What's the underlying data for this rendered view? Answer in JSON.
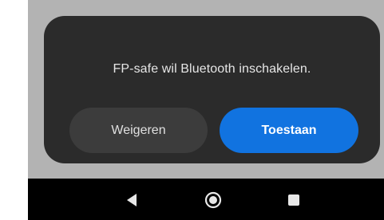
{
  "dialog": {
    "message": "FP-safe wil Bluetooth inschakelen.",
    "deny_label": "Weigeren",
    "allow_label": "Toestaan"
  },
  "navbar": {
    "back_icon": "back-triangle-icon",
    "home_icon": "home-circle-icon",
    "recents_icon": "recents-square-icon"
  },
  "colors": {
    "scrim": "#b3b3b3",
    "dialog_bg": "#2b2b2b",
    "deny_bg": "#3c3c3c",
    "accent": "#1173e0",
    "navbar_bg": "#000000"
  }
}
